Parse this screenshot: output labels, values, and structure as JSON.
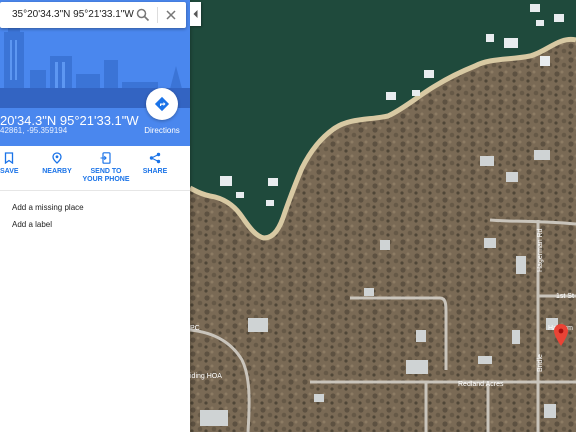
{
  "search": {
    "value": "35°20'34.3\"N 95°21'33.1\"W"
  },
  "place": {
    "title": "20'34.3\"N 95°21'33.1\"W",
    "decimal": "42861, -95.359194"
  },
  "directions": {
    "label": "Directions"
  },
  "actions": [
    {
      "label": "SAVE",
      "icon": "bookmark-icon"
    },
    {
      "label": "NEARBY",
      "icon": "nearby-icon"
    },
    {
      "label": "SEND TO YOUR PHONE",
      "icon": "send-to-phone-icon"
    },
    {
      "label": "SHARE",
      "icon": "share-icon"
    }
  ],
  "links": {
    "add_missing_place": "Add a missing place",
    "add_label": "Add a label"
  },
  "map": {
    "labels": {
      "hagerman_rd": "Hagerman Rd",
      "first_st": "1st St",
      "redland_acres": "Redland Acres",
      "bridle": "Bridle",
      "riding_hoa": "iding HOA",
      "hagerman_short": "Hagerm",
      "pc": "PC"
    },
    "colors": {
      "water": "#1f4a3c",
      "shore": "#d8c9a3",
      "land": "#7a6a55",
      "road": "#c9c4bb",
      "pin": "#ea4335"
    }
  }
}
